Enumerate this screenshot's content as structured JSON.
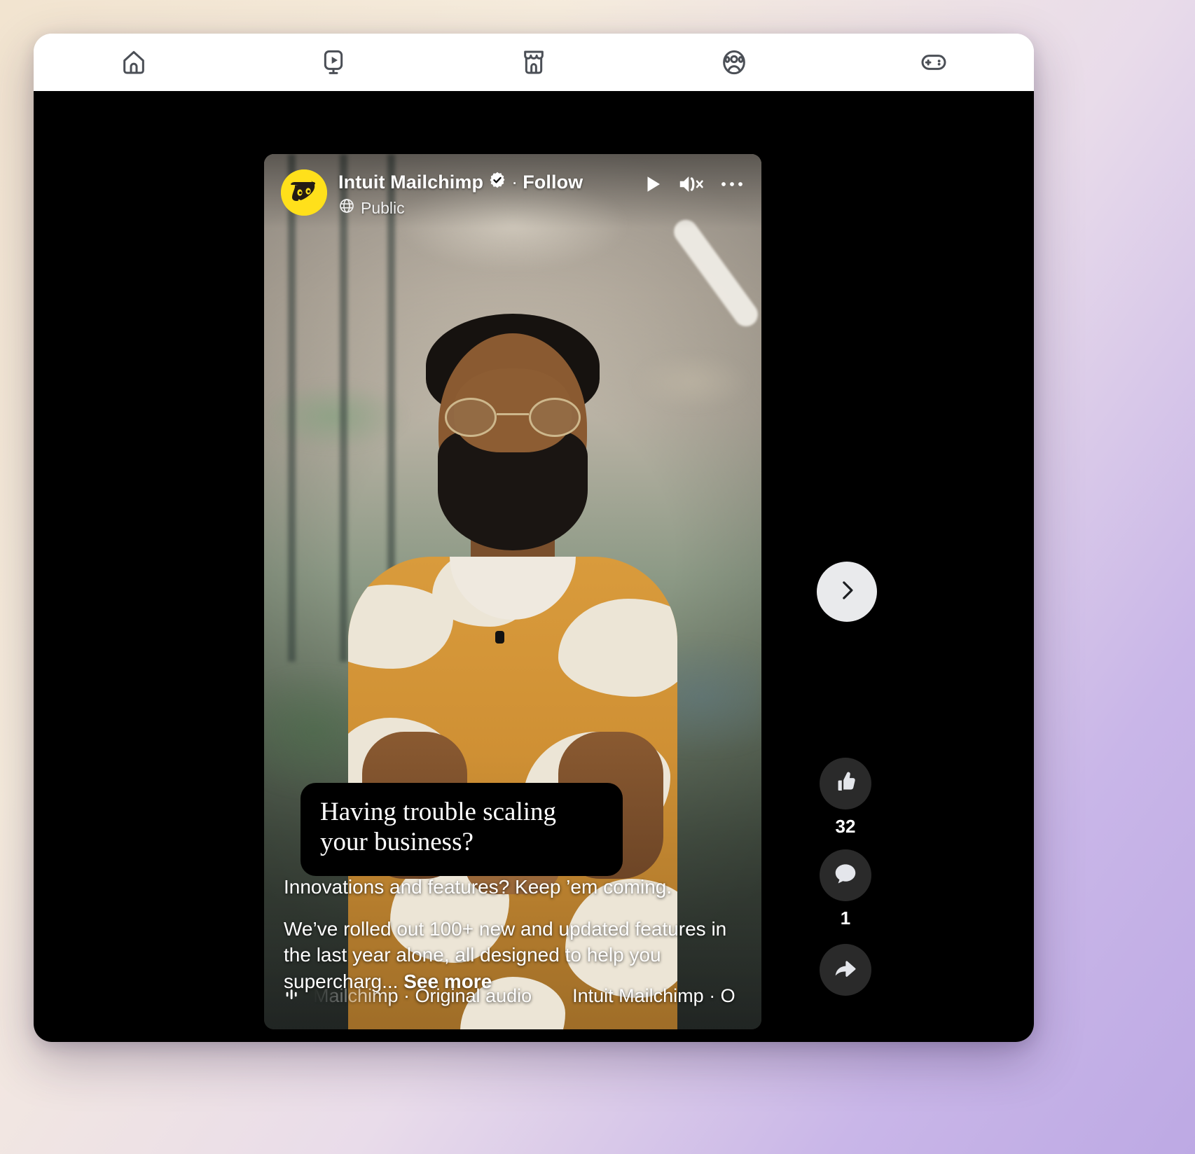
{
  "topnav": {
    "tabs": [
      {
        "name": "home-tab",
        "icon": "home-icon",
        "label": "Home"
      },
      {
        "name": "video-tab",
        "icon": "video-play-icon",
        "label": "Video"
      },
      {
        "name": "marketplace-tab",
        "icon": "marketplace-store-icon",
        "label": "Marketplace"
      },
      {
        "name": "groups-tab",
        "icon": "groups-people-icon",
        "label": "Groups"
      },
      {
        "name": "gaming-tab",
        "icon": "gaming-controller-icon",
        "label": "Gaming"
      }
    ]
  },
  "post": {
    "author": "Intuit Mailchimp",
    "verified_badge": "verified-check-icon",
    "separator": "·",
    "follow_label": "Follow",
    "privacy": "Public",
    "privacy_icon": "globe-icon",
    "avatar_icon": "mailchimp-freddie-avatar",
    "controls": {
      "play_label": "play-icon",
      "mute_label": "speaker-muted-icon",
      "menu_label": "more-options-icon"
    },
    "subtitle": "Having trouble scaling your business?",
    "caption_lead": "Innovations and features? Keep ’em coming.",
    "caption_body": "We’ve rolled out 100+ new and updated features in the last year alone, all designed to help you supercharg...",
    "see_more_label": "See more",
    "audio_icon": "audio-waveform-icon",
    "audio_attribution": "Mailchimp · Original audio",
    "audio_attribution_2": "Intuit Mailchimp · O"
  },
  "actions": {
    "next_label": "chevron-right-icon",
    "items": [
      {
        "name": "like-button",
        "icon": "thumbs-up-icon",
        "count": "32"
      },
      {
        "name": "comment-button",
        "icon": "comment-bubble-icon",
        "count": "1"
      },
      {
        "name": "share-button",
        "icon": "share-arrow-icon",
        "count": ""
      }
    ]
  },
  "colors": {
    "brand_yellow": "#ffe01b",
    "rail_bg": "#2a2a2a",
    "stage_bg": "#000000",
    "next_btn_bg": "#e9eaec"
  }
}
